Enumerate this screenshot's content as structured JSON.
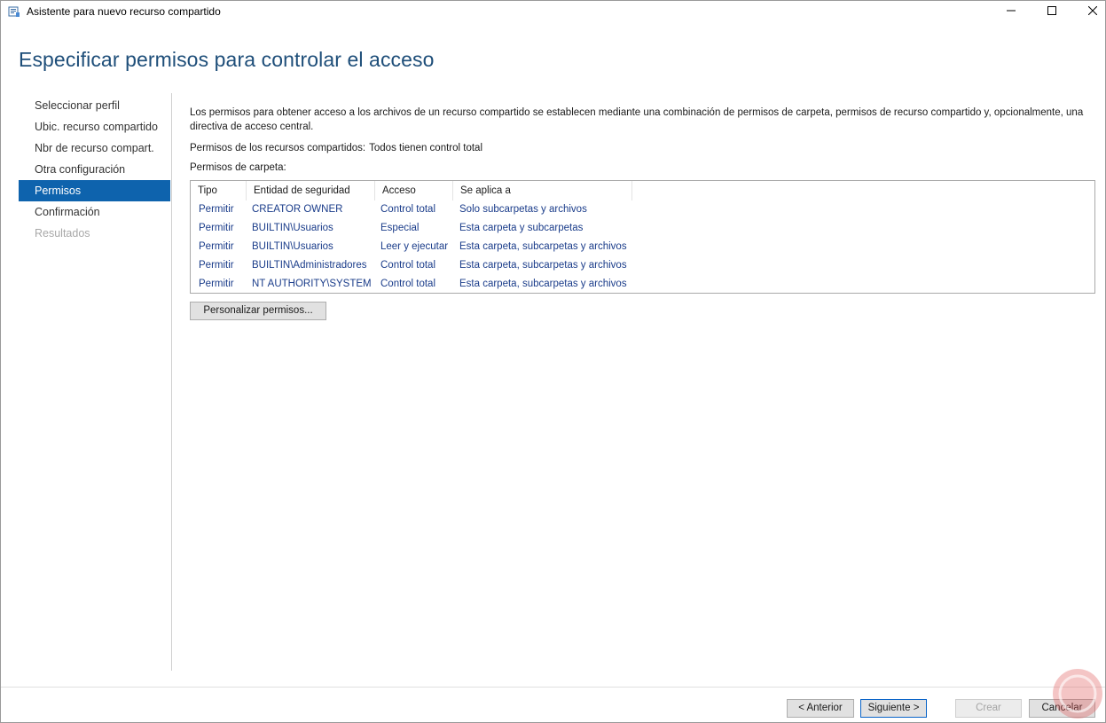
{
  "window": {
    "title": "Asistente para nuevo recurso compartido",
    "controls": {
      "minimize": "minimize-icon",
      "maximize": "maximize-icon",
      "close": "close-icon"
    }
  },
  "page": {
    "heading": "Especificar permisos para controlar el acceso"
  },
  "nav": {
    "items": [
      {
        "label": "Seleccionar perfil",
        "state": "normal"
      },
      {
        "label": "Ubic. recurso compartido",
        "state": "normal"
      },
      {
        "label": "Nbr de recurso compart.",
        "state": "normal"
      },
      {
        "label": "Otra configuración",
        "state": "normal"
      },
      {
        "label": "Permisos",
        "state": "active"
      },
      {
        "label": "Confirmación",
        "state": "normal"
      },
      {
        "label": "Resultados",
        "state": "disabled"
      }
    ]
  },
  "content": {
    "description": "Los permisos para obtener acceso a los archivos de un recurso compartido se establecen mediante una combinación de permisos de carpeta, permisos de recurso compartido y, opcionalmente, una directiva de acceso central.",
    "share_permissions_label": "Permisos de los recursos compartidos:",
    "share_permissions_value": "Todos tienen control total",
    "folder_permissions_label": "Permisos de carpeta:",
    "table": {
      "columns": [
        "Tipo",
        "Entidad de seguridad",
        "Acceso",
        "Se aplica a"
      ],
      "rows": [
        [
          "Permitir",
          "CREATOR OWNER",
          "Control total",
          "Solo subcarpetas y archivos"
        ],
        [
          "Permitir",
          "BUILTIN\\Usuarios",
          "Especial",
          "Esta carpeta y subcarpetas"
        ],
        [
          "Permitir",
          "BUILTIN\\Usuarios",
          "Leer y ejecutar",
          "Esta carpeta, subcarpetas y archivos"
        ],
        [
          "Permitir",
          "BUILTIN\\Administradores",
          "Control total",
          "Esta carpeta, subcarpetas y archivos"
        ],
        [
          "Permitir",
          "NT AUTHORITY\\SYSTEM",
          "Control total",
          "Esta carpeta, subcarpetas y archivos"
        ]
      ]
    },
    "customize_button": "Personalizar permisos..."
  },
  "footer": {
    "back": "< Anterior",
    "next": "Siguiente >",
    "create": "Crear",
    "cancel": "Cancelar"
  },
  "colors": {
    "heading": "#1e4e79",
    "nav_active_bg": "#0e63ad",
    "table_text": "#1a3c8a",
    "next_border": "#0a64c8"
  }
}
